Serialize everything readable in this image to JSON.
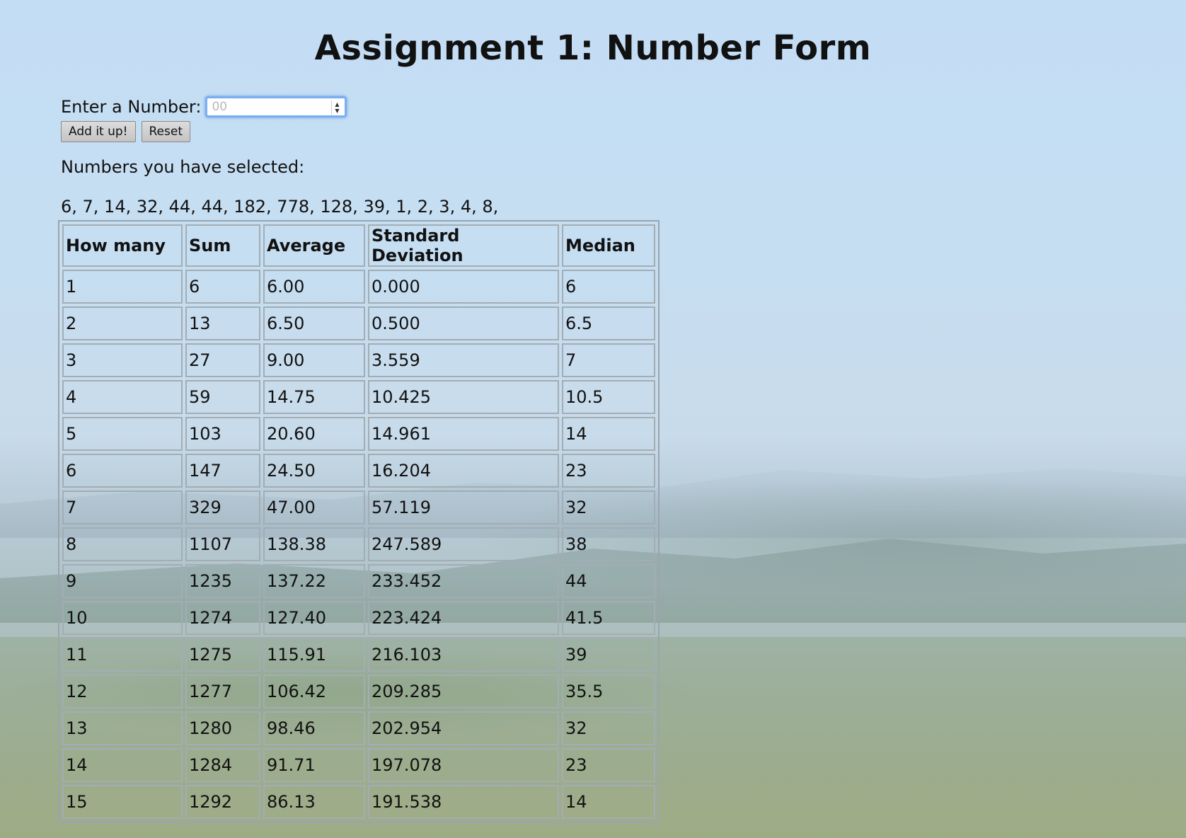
{
  "page": {
    "title": "Assignment 1: Number Form"
  },
  "form": {
    "label": "Enter a Number:",
    "input_placeholder": "00",
    "input_value": "",
    "add_button_label": "Add it up!",
    "reset_button_label": "Reset"
  },
  "selection": {
    "label": "Numbers you have selected:",
    "numbers_text": "6, 7, 14, 32, 44, 44, 182, 778, 128, 39, 1, 2, 3, 4, 8,"
  },
  "table": {
    "headers": [
      "How many",
      "Sum",
      "Average",
      "Standard Deviation",
      "Median"
    ],
    "rows": [
      [
        "1",
        "6",
        "6.00",
        "0.000",
        "6"
      ],
      [
        "2",
        "13",
        "6.50",
        "0.500",
        "6.5"
      ],
      [
        "3",
        "27",
        "9.00",
        "3.559",
        "7"
      ],
      [
        "4",
        "59",
        "14.75",
        "10.425",
        "10.5"
      ],
      [
        "5",
        "103",
        "20.60",
        "14.961",
        "14"
      ],
      [
        "6",
        "147",
        "24.50",
        "16.204",
        "23"
      ],
      [
        "7",
        "329",
        "47.00",
        "57.119",
        "32"
      ],
      [
        "8",
        "1107",
        "138.38",
        "247.589",
        "38"
      ],
      [
        "9",
        "1235",
        "137.22",
        "233.452",
        "44"
      ],
      [
        "10",
        "1274",
        "127.40",
        "223.424",
        "41.5"
      ],
      [
        "11",
        "1275",
        "115.91",
        "216.103",
        "39"
      ],
      [
        "12",
        "1277",
        "106.42",
        "209.285",
        "35.5"
      ],
      [
        "13",
        "1280",
        "98.46",
        "202.954",
        "32"
      ],
      [
        "14",
        "1284",
        "91.71",
        "197.078",
        "23"
      ],
      [
        "15",
        "1292",
        "86.13",
        "191.538",
        "14"
      ]
    ]
  },
  "icons": {
    "spinner": "number-spinner-icon"
  }
}
